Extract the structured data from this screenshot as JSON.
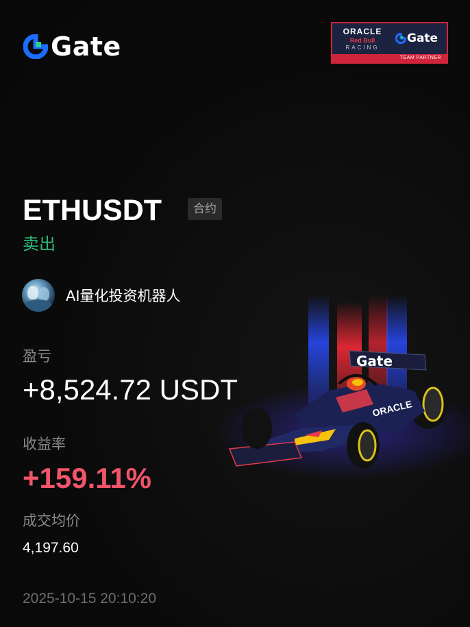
{
  "brand": {
    "logo_text": "Gate",
    "logo_icon": "gate-logo-icon",
    "accent_blue": "#1a6dff",
    "accent_green": "#2ad18a"
  },
  "partner_badge": {
    "line1": "ORACLE",
    "line2": "Red Bull",
    "line3": "RACING",
    "gate_text": "Gate",
    "strip_text": "TEAM PARTNER"
  },
  "trade": {
    "pair": "ETHUSDT",
    "tag": "合约",
    "side": "卖出",
    "side_color": "#2cbf7a"
  },
  "bot": {
    "name": "AI量化投资机器人",
    "avatar_icon": "robot-avatar-icon"
  },
  "stats": {
    "pnl_label": "盈亏",
    "pnl_value": "+8,524.72 USDT",
    "roi_label": "收益率",
    "roi_value": "+159.11%",
    "roi_color": "#f0556a",
    "avg_label": "成交均价",
    "avg_value": "4,197.60",
    "timestamp": "2025-10-15 20:10:20"
  },
  "illustration": {
    "icon": "f1-race-car-illustration",
    "wing_text": "Gate",
    "sidepod_text": "ORACLE"
  }
}
